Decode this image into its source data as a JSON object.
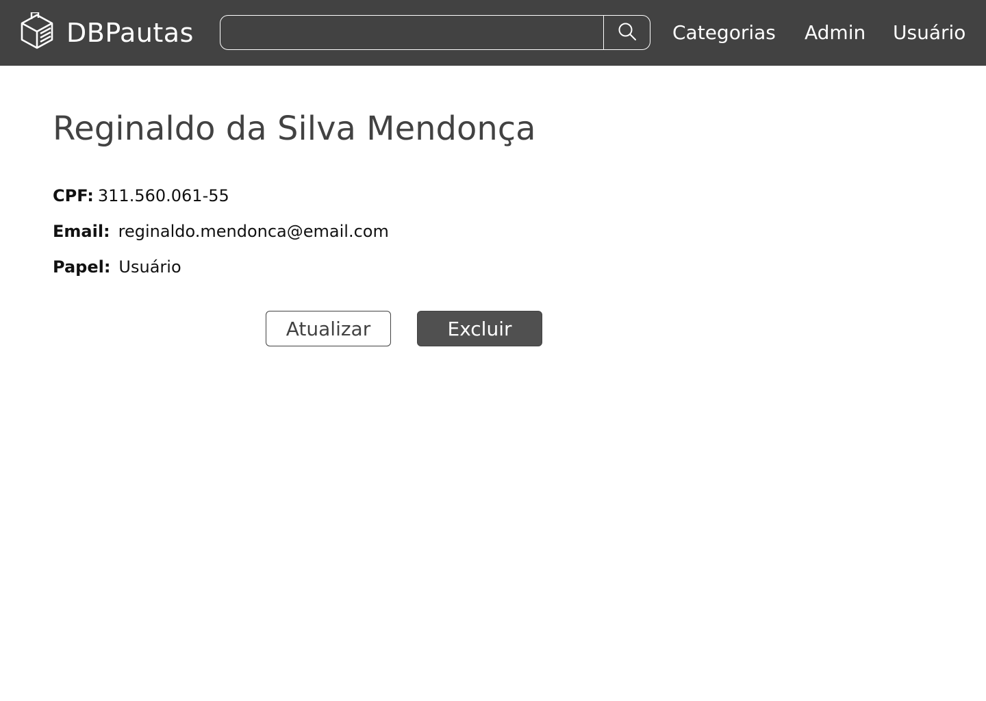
{
  "header": {
    "brand": "DBPautas",
    "logo_icon": "ballot-box-icon",
    "search": {
      "value": "",
      "placeholder": "",
      "button_icon": "search-icon"
    },
    "nav": {
      "categorias": "Categorias",
      "admin": "Admin",
      "usuario": "Usuário"
    },
    "colors": {
      "navbar_bg": "#424242",
      "text": "#ffffff"
    }
  },
  "profile": {
    "name": "Reginaldo da Silva Mendonça",
    "fields": {
      "cpf_label": "CPF:",
      "cpf_value": "311.560.061-55",
      "email_label": "Email:",
      "email_value": "reginaldo.mendonca@email.com",
      "papel_label": "Papel:",
      "papel_value": "Usuário"
    }
  },
  "actions": {
    "update_label": "Atualizar",
    "delete_label": "Excluir",
    "delete_color": "#505050"
  }
}
